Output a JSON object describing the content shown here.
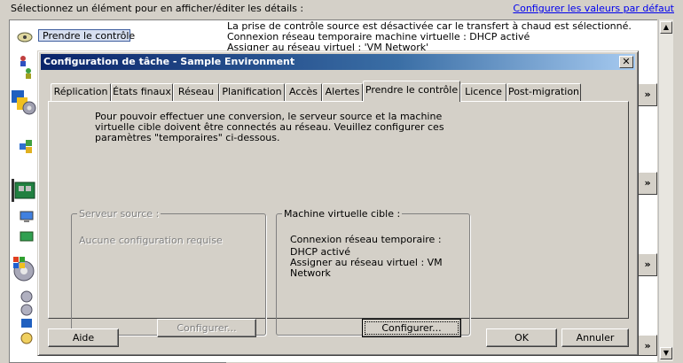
{
  "background": {
    "instruction": "Sélectionnez un élément pour en afficher/éditer les détails :",
    "link": "Configurer les valeurs par défaut",
    "selected_item": "Prendre le contrôle",
    "info_lines": [
      "La prise de contrôle source est désactivée car le transfert à chaud est sélectionné.",
      "Connexion réseau temporaire machine virtuelle : DHCP activé",
      "Assigner au réseau virtuel : 'VM Network'"
    ]
  },
  "dialog": {
    "title": "Configuration de tâche - Sample Environment",
    "close_symbol": "✕",
    "tabs": [
      {
        "label": "Réplication",
        "active": false
      },
      {
        "label": "États finaux",
        "active": false
      },
      {
        "label": "Réseau",
        "active": false
      },
      {
        "label": "Planification",
        "active": false
      },
      {
        "label": "Accès",
        "active": false
      },
      {
        "label": "Alertes",
        "active": false
      },
      {
        "label": "Prendre le contrôle",
        "active": true
      },
      {
        "label": "Licence",
        "active": false
      },
      {
        "label": "Post-migration",
        "active": false
      }
    ],
    "intro_text": "Pour pouvoir effectuer une conversion, le serveur source et la machine virtuelle cible doivent être connectés au réseau. Veuillez configurer ces paramètres \"temporaires\" ci-dessous.",
    "source_group": {
      "legend": "Serveur source :",
      "body": "Aucune configuration requise",
      "button": "Configurer...",
      "enabled": false
    },
    "target_group": {
      "legend": "Machine virtuelle cible :",
      "body_lines": [
        "Connexion réseau temporaire :",
        "DHCP activé",
        "Assigner au réseau virtuel : VM",
        "Network"
      ],
      "button": "Configurer...",
      "enabled": true
    },
    "help_button": "Aide",
    "ok_button": "OK",
    "cancel_button": "Annuler"
  }
}
